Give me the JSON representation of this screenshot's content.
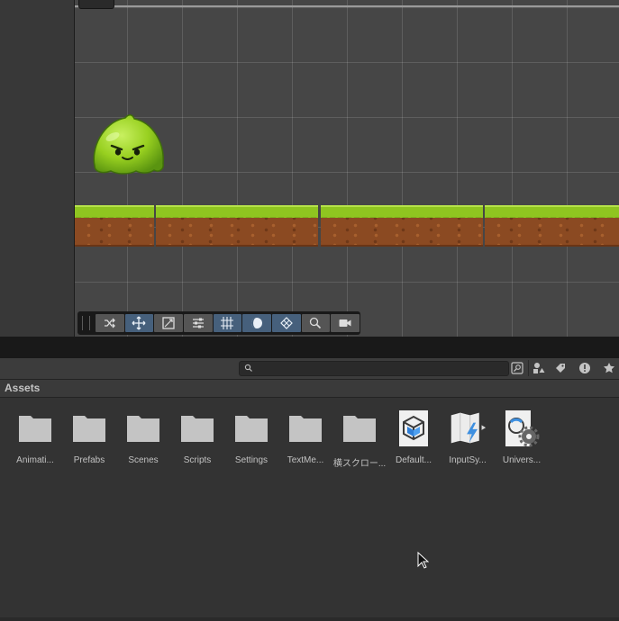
{
  "scene": {
    "toolbar": {
      "tools": [
        {
          "name": "shuffle-tool-icon",
          "active": false
        },
        {
          "name": "move-tool-icon",
          "active": true
        },
        {
          "name": "rect-tool-icon",
          "active": false
        },
        {
          "name": "settings-tool-icon",
          "active": false
        },
        {
          "name": "grid-tool-icon",
          "active": true
        },
        {
          "name": "shading-tool-icon",
          "active": true
        },
        {
          "name": "snap-tool-icon",
          "active": true
        },
        {
          "name": "zoom-icon",
          "active": false
        },
        {
          "name": "camera-icon",
          "active": false
        }
      ]
    }
  },
  "project": {
    "search": {
      "value": "",
      "placeholder": ""
    },
    "breadcrumb": "Assets",
    "assets": [
      {
        "label": "Animati...",
        "icon": "folder-icon"
      },
      {
        "label": "Prefabs",
        "icon": "folder-icon"
      },
      {
        "label": "Scenes",
        "icon": "folder-icon"
      },
      {
        "label": "Scripts",
        "icon": "folder-icon"
      },
      {
        "label": "Settings",
        "icon": "folder-icon"
      },
      {
        "label": "TextMe...",
        "icon": "folder-icon"
      },
      {
        "label": "横スクロー...",
        "icon": "folder-icon"
      },
      {
        "label": "Default...",
        "icon": "package-icon"
      },
      {
        "label": "InputSy...",
        "icon": "input-actions-icon"
      },
      {
        "label": "Univers...",
        "icon": "render-pipeline-asset-icon"
      }
    ]
  },
  "colors": {
    "active_tool": "#46607c",
    "folder": "#c4c4c4",
    "grass": "#8fc520",
    "dirt": "#8b4a22",
    "slime": "#9fd62c"
  }
}
